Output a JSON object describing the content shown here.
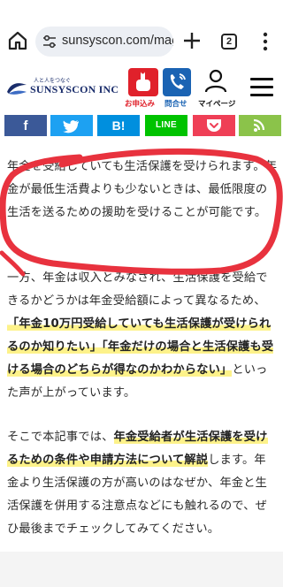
{
  "browser": {
    "url": "sunsyscon.com/mag",
    "tab_count": "2"
  },
  "site": {
    "logo_tagline": "人と人をつなぐ",
    "logo_name": "SUNSYSCON INC",
    "apply_label": "お申込み",
    "contact_label": "問合せ",
    "mypage_label": "マイページ"
  },
  "share": {
    "facebook": "f",
    "twitter": "t",
    "hatena": "B!",
    "line": "LINE"
  },
  "article": {
    "p1": "年金を受給していても生活保護を受けられます。年金が最低生活費よりも少ないときは、最低限度の生活を送るための援助を受けることが可能です。",
    "p2_a": "一方、年金は収入とみなされ、生活保護を受給できるかどうかは年金受給額によって異なるため、",
    "p2_hl": "「年金10万円受給していても生活保護が受けられるのか知りたい」「年金だけの場合と生活保護も受ける場合のどちらが得なのかわからない」",
    "p2_b": "といった声が上がっています。",
    "p3_a": "そこで本記事では、",
    "p3_hl": "年金受給者が生活保護を受けるための条件や申請方法について解説",
    "p3_b": "します。年金より生活保護の方が高いのはなぜか、年金と生活保護を併用する注意点などにも触れるので、ぜひ最後までチェックしてみてください。"
  },
  "colors": {
    "apply": "#e0212b",
    "contact": "#1a63b3",
    "highlight": "#fdf28a",
    "scribble": "#e8323e",
    "brand": "#1a2d6b"
  }
}
